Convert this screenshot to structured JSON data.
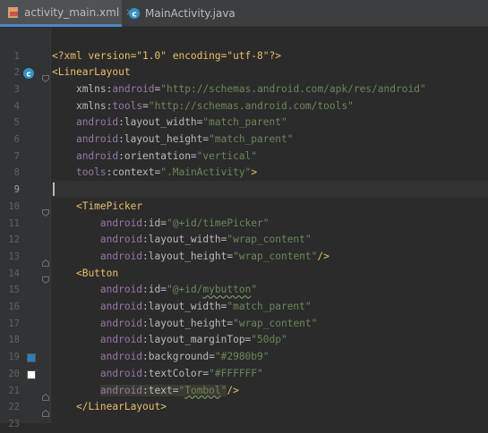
{
  "tabs": [
    {
      "label": "activity_main.xml",
      "icon": "xml-file-icon",
      "active": true,
      "close": "×"
    },
    {
      "label": "MainActivity.java",
      "icon": "java-class-icon",
      "active": false
    }
  ],
  "editor": {
    "current_line": 9,
    "line_numbers": [
      "1",
      "2",
      "3",
      "4",
      "5",
      "6",
      "7",
      "8",
      "9",
      "10",
      "11",
      "12",
      "13",
      "14",
      "15",
      "16",
      "17",
      "18",
      "19",
      "20",
      "21",
      "22",
      "23"
    ],
    "lines": [
      [
        [
          "<?",
          "bracket"
        ],
        [
          "xml version=\"1.0\" encoding=\"utf-8\"",
          "bracket-text"
        ],
        [
          "?>",
          "bracket"
        ]
      ],
      [
        [
          "<",
          "bracket"
        ],
        [
          "LinearLayout",
          "tag"
        ]
      ],
      [
        [
          "    ",
          "text"
        ],
        [
          "xmlns",
          "attr"
        ],
        [
          ":",
          "attr"
        ],
        [
          "android",
          "ns"
        ],
        [
          "=",
          "attr"
        ],
        [
          "\"http://schemas.android.com/apk/res/android\"",
          "val"
        ]
      ],
      [
        [
          "    ",
          "text"
        ],
        [
          "xmlns",
          "attr"
        ],
        [
          ":",
          "attr"
        ],
        [
          "tools",
          "ns"
        ],
        [
          "=",
          "attr"
        ],
        [
          "\"http://schemas.android.com/tools\"",
          "val"
        ]
      ],
      [
        [
          "    ",
          "text"
        ],
        [
          "android",
          "ns"
        ],
        [
          ":layout_width=",
          "attr"
        ],
        [
          "\"match_parent\"",
          "val"
        ]
      ],
      [
        [
          "    ",
          "text"
        ],
        [
          "android",
          "ns"
        ],
        [
          ":layout_height=",
          "attr"
        ],
        [
          "\"match_parent\"",
          "val"
        ]
      ],
      [
        [
          "    ",
          "text"
        ],
        [
          "android",
          "ns"
        ],
        [
          ":orientation=",
          "attr"
        ],
        [
          "\"vertical\"",
          "val"
        ]
      ],
      [
        [
          "    ",
          "text"
        ],
        [
          "tools",
          "ns"
        ],
        [
          ":context=",
          "attr"
        ],
        [
          "\".MainActivity\"",
          "val"
        ],
        [
          ">",
          "bracket"
        ]
      ],
      [],
      [
        [
          "    ",
          "text"
        ],
        [
          "<",
          "bracket"
        ],
        [
          "TimePicker",
          "tag"
        ]
      ],
      [
        [
          "        ",
          "text"
        ],
        [
          "android",
          "ns"
        ],
        [
          ":id=",
          "attr"
        ],
        [
          "\"@+id/timePicker\"",
          "val"
        ]
      ],
      [
        [
          "        ",
          "text"
        ],
        [
          "android",
          "ns"
        ],
        [
          ":layout_width=",
          "attr"
        ],
        [
          "\"wrap_content\"",
          "val"
        ]
      ],
      [
        [
          "        ",
          "text"
        ],
        [
          "android",
          "ns"
        ],
        [
          ":layout_height=",
          "attr"
        ],
        [
          "\"wrap_content\"",
          "val"
        ],
        [
          "/>",
          "bracket"
        ]
      ],
      [
        [
          "    ",
          "text"
        ],
        [
          "<",
          "bracket"
        ],
        [
          "Button",
          "tag"
        ]
      ],
      [
        [
          "        ",
          "text"
        ],
        [
          "android",
          "ns"
        ],
        [
          ":id=",
          "attr"
        ],
        [
          "\"@+id/",
          "val"
        ],
        [
          "mybutton",
          "val-squiggle"
        ],
        [
          "\"",
          "val"
        ]
      ],
      [
        [
          "        ",
          "text"
        ],
        [
          "android",
          "ns"
        ],
        [
          ":layout_width=",
          "attr"
        ],
        [
          "\"match_parent\"",
          "val"
        ]
      ],
      [
        [
          "        ",
          "text"
        ],
        [
          "android",
          "ns"
        ],
        [
          ":layout_height=",
          "attr"
        ],
        [
          "\"wrap_content\"",
          "val"
        ]
      ],
      [
        [
          "        ",
          "text"
        ],
        [
          "android",
          "ns"
        ],
        [
          ":layout_marginTop=",
          "attr"
        ],
        [
          "\"50dp\"",
          "val"
        ]
      ],
      [
        [
          "        ",
          "text"
        ],
        [
          "android",
          "ns"
        ],
        [
          ":background=",
          "attr"
        ],
        [
          "\"#2980b9\"",
          "val"
        ]
      ],
      [
        [
          "        ",
          "text"
        ],
        [
          "android",
          "ns"
        ],
        [
          ":textColor=",
          "attr"
        ],
        [
          "\"#FFFFFF\"",
          "val"
        ]
      ],
      [
        [
          "        ",
          "text"
        ],
        [
          "android",
          "ns-sel"
        ],
        [
          ":text=",
          "attr-sel"
        ],
        [
          "\"",
          "val-sel"
        ],
        [
          "Tombol",
          "val-sel-squiggle"
        ],
        [
          "\"",
          "val-sel"
        ],
        [
          "/>",
          "bracket"
        ]
      ],
      [
        [
          "    ",
          "text"
        ],
        [
          "</",
          "bracket"
        ],
        [
          "LinearLayout",
          "tag"
        ],
        [
          ">",
          "bracket"
        ]
      ],
      []
    ]
  },
  "gutter_marks": [
    {
      "line": 2,
      "icon": "activity-class-icon"
    },
    {
      "line": 19,
      "icon": "color-swatch-icon",
      "color": "#2980b9"
    },
    {
      "line": 20,
      "icon": "color-swatch-icon",
      "color": "#FFFFFF"
    }
  ],
  "fold_marks": [
    {
      "line": 2,
      "icon": "fold-open-icon"
    },
    {
      "line": 10,
      "icon": "fold-open-icon"
    },
    {
      "line": 13,
      "icon": "fold-close-icon"
    },
    {
      "line": 14,
      "icon": "fold-open-icon"
    },
    {
      "line": 21,
      "icon": "fold-close-icon"
    },
    {
      "line": 22,
      "icon": "fold-close-icon"
    }
  ],
  "colors": {
    "editor_bg": "#2b2b2b",
    "gutter_bg": "#313335",
    "tag": "#e8bf6a",
    "namespace": "#9876aa",
    "attribute": "#bababa",
    "value": "#6a8759",
    "accent": "#4a88c7"
  }
}
